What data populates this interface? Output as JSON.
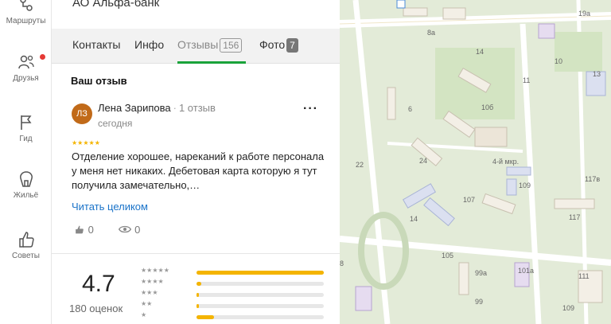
{
  "sidebar": {
    "items": [
      {
        "label": "Маршруты",
        "icon": "route-icon"
      },
      {
        "label": "Друзья",
        "icon": "friends-icon"
      },
      {
        "label": "Гид",
        "icon": "flag-icon"
      },
      {
        "label": "Жильё",
        "icon": "house-icon"
      },
      {
        "label": "Советы",
        "icon": "thumbs-up-icon"
      }
    ]
  },
  "org": {
    "name": "АО Альфа-банк"
  },
  "tabs": [
    {
      "label": "Контакты"
    },
    {
      "label": "Инфо"
    },
    {
      "label": "Отзывы",
      "count": "156"
    },
    {
      "label": "Фото",
      "count": "7"
    }
  ],
  "review": {
    "section_title": "Ваш отзыв",
    "avatar_initials": "ЛЗ",
    "author": "Лена Зарипова",
    "author_reviews": "1 отзыв",
    "date": "сегодня",
    "stars": "★★★★★",
    "text": "Отделение хорошее, нареканий к работе персонала у меня нет никаких. Дебетовая карта которую я тут получила замечательно,…",
    "read_more": "Читать целиком",
    "likes": "0",
    "views": "0",
    "more_menu": "···"
  },
  "rating": {
    "value": "4.7",
    "count_label": "180 оценок",
    "distribution": [
      {
        "stars": "★★★★★",
        "fraction": 1.0
      },
      {
        "stars": "★★★★",
        "fraction": 0.04
      },
      {
        "stars": "★★★",
        "fraction": 0.02
      },
      {
        "stars": "★★",
        "fraction": 0.02
      },
      {
        "stars": "★",
        "fraction": 0.14
      }
    ]
  },
  "map": {
    "labels": [
      "8а",
      "19а",
      "14",
      "10",
      "11",
      "13",
      "6",
      "10б",
      "22",
      "24",
      "4-й мкр.",
      "109",
      "107",
      "14",
      "117в",
      "117",
      "105",
      "101а",
      "99а",
      "111",
      "99",
      "109",
      "8"
    ]
  },
  "colors": {
    "accent_green": "#1aa33a",
    "star": "#f4b400",
    "link": "#1a73c9",
    "avatar": "#c16a19",
    "notify": "#e53935"
  }
}
